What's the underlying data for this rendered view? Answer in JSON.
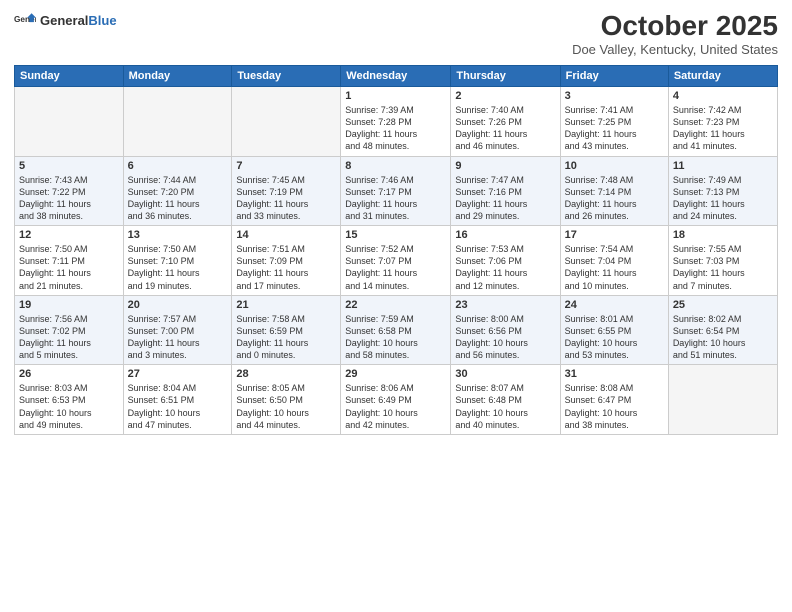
{
  "logo": {
    "general": "General",
    "blue": "Blue"
  },
  "title": "October 2025",
  "location": "Doe Valley, Kentucky, United States",
  "weekdays": [
    "Sunday",
    "Monday",
    "Tuesday",
    "Wednesday",
    "Thursday",
    "Friday",
    "Saturday"
  ],
  "weeks": [
    [
      {
        "day": "",
        "info": ""
      },
      {
        "day": "",
        "info": ""
      },
      {
        "day": "",
        "info": ""
      },
      {
        "day": "1",
        "info": "Sunrise: 7:39 AM\nSunset: 7:28 PM\nDaylight: 11 hours\nand 48 minutes."
      },
      {
        "day": "2",
        "info": "Sunrise: 7:40 AM\nSunset: 7:26 PM\nDaylight: 11 hours\nand 46 minutes."
      },
      {
        "day": "3",
        "info": "Sunrise: 7:41 AM\nSunset: 7:25 PM\nDaylight: 11 hours\nand 43 minutes."
      },
      {
        "day": "4",
        "info": "Sunrise: 7:42 AM\nSunset: 7:23 PM\nDaylight: 11 hours\nand 41 minutes."
      }
    ],
    [
      {
        "day": "5",
        "info": "Sunrise: 7:43 AM\nSunset: 7:22 PM\nDaylight: 11 hours\nand 38 minutes."
      },
      {
        "day": "6",
        "info": "Sunrise: 7:44 AM\nSunset: 7:20 PM\nDaylight: 11 hours\nand 36 minutes."
      },
      {
        "day": "7",
        "info": "Sunrise: 7:45 AM\nSunset: 7:19 PM\nDaylight: 11 hours\nand 33 minutes."
      },
      {
        "day": "8",
        "info": "Sunrise: 7:46 AM\nSunset: 7:17 PM\nDaylight: 11 hours\nand 31 minutes."
      },
      {
        "day": "9",
        "info": "Sunrise: 7:47 AM\nSunset: 7:16 PM\nDaylight: 11 hours\nand 29 minutes."
      },
      {
        "day": "10",
        "info": "Sunrise: 7:48 AM\nSunset: 7:14 PM\nDaylight: 11 hours\nand 26 minutes."
      },
      {
        "day": "11",
        "info": "Sunrise: 7:49 AM\nSunset: 7:13 PM\nDaylight: 11 hours\nand 24 minutes."
      }
    ],
    [
      {
        "day": "12",
        "info": "Sunrise: 7:50 AM\nSunset: 7:11 PM\nDaylight: 11 hours\nand 21 minutes."
      },
      {
        "day": "13",
        "info": "Sunrise: 7:50 AM\nSunset: 7:10 PM\nDaylight: 11 hours\nand 19 minutes."
      },
      {
        "day": "14",
        "info": "Sunrise: 7:51 AM\nSunset: 7:09 PM\nDaylight: 11 hours\nand 17 minutes."
      },
      {
        "day": "15",
        "info": "Sunrise: 7:52 AM\nSunset: 7:07 PM\nDaylight: 11 hours\nand 14 minutes."
      },
      {
        "day": "16",
        "info": "Sunrise: 7:53 AM\nSunset: 7:06 PM\nDaylight: 11 hours\nand 12 minutes."
      },
      {
        "day": "17",
        "info": "Sunrise: 7:54 AM\nSunset: 7:04 PM\nDaylight: 11 hours\nand 10 minutes."
      },
      {
        "day": "18",
        "info": "Sunrise: 7:55 AM\nSunset: 7:03 PM\nDaylight: 11 hours\nand 7 minutes."
      }
    ],
    [
      {
        "day": "19",
        "info": "Sunrise: 7:56 AM\nSunset: 7:02 PM\nDaylight: 11 hours\nand 5 minutes."
      },
      {
        "day": "20",
        "info": "Sunrise: 7:57 AM\nSunset: 7:00 PM\nDaylight: 11 hours\nand 3 minutes."
      },
      {
        "day": "21",
        "info": "Sunrise: 7:58 AM\nSunset: 6:59 PM\nDaylight: 11 hours\nand 0 minutes."
      },
      {
        "day": "22",
        "info": "Sunrise: 7:59 AM\nSunset: 6:58 PM\nDaylight: 10 hours\nand 58 minutes."
      },
      {
        "day": "23",
        "info": "Sunrise: 8:00 AM\nSunset: 6:56 PM\nDaylight: 10 hours\nand 56 minutes."
      },
      {
        "day": "24",
        "info": "Sunrise: 8:01 AM\nSunset: 6:55 PM\nDaylight: 10 hours\nand 53 minutes."
      },
      {
        "day": "25",
        "info": "Sunrise: 8:02 AM\nSunset: 6:54 PM\nDaylight: 10 hours\nand 51 minutes."
      }
    ],
    [
      {
        "day": "26",
        "info": "Sunrise: 8:03 AM\nSunset: 6:53 PM\nDaylight: 10 hours\nand 49 minutes."
      },
      {
        "day": "27",
        "info": "Sunrise: 8:04 AM\nSunset: 6:51 PM\nDaylight: 10 hours\nand 47 minutes."
      },
      {
        "day": "28",
        "info": "Sunrise: 8:05 AM\nSunset: 6:50 PM\nDaylight: 10 hours\nand 44 minutes."
      },
      {
        "day": "29",
        "info": "Sunrise: 8:06 AM\nSunset: 6:49 PM\nDaylight: 10 hours\nand 42 minutes."
      },
      {
        "day": "30",
        "info": "Sunrise: 8:07 AM\nSunset: 6:48 PM\nDaylight: 10 hours\nand 40 minutes."
      },
      {
        "day": "31",
        "info": "Sunrise: 8:08 AM\nSunset: 6:47 PM\nDaylight: 10 hours\nand 38 minutes."
      },
      {
        "day": "",
        "info": ""
      }
    ]
  ],
  "row_alts": [
    false,
    true,
    false,
    true,
    false
  ]
}
